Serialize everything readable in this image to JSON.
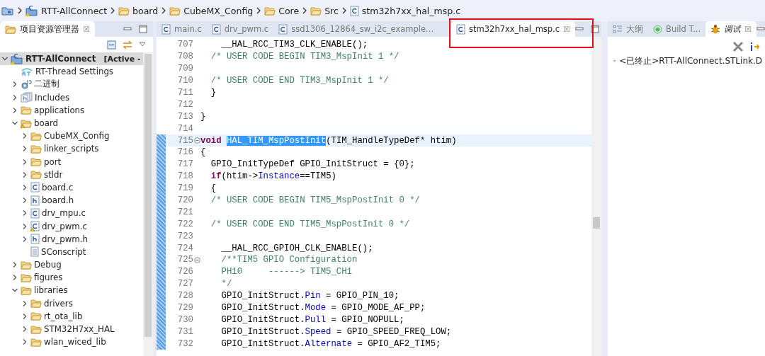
{
  "breadcrumb": [
    {
      "label": "RTT-AllConnect",
      "kind": "project"
    },
    {
      "label": "board",
      "kind": "folder"
    },
    {
      "label": "CubeMX_Config",
      "kind": "folder"
    },
    {
      "label": "Core",
      "kind": "folder"
    },
    {
      "label": "Src",
      "kind": "folder"
    },
    {
      "label": "stm32h7xx_hal_msp.c",
      "kind": "c-file"
    }
  ],
  "explorer": {
    "title": "项目资源管理器",
    "close": "☒",
    "tree": [
      {
        "label": "RTT-AllConnect",
        "suffix": "[Active - ",
        "kind": "project",
        "selected": true,
        "expanded": true,
        "children": [
          {
            "label": "RT-Thread Settings",
            "kind": "rt",
            "selected": false
          },
          {
            "label": "二进制",
            "kind": "binary",
            "selected": false,
            "expanded": false
          },
          {
            "label": "Includes",
            "kind": "includes",
            "selected": false,
            "expanded": false
          },
          {
            "label": "applications",
            "kind": "folder",
            "selected": false,
            "expanded": false
          },
          {
            "label": "board",
            "kind": "folder",
            "selected": false,
            "expanded": true,
            "warning": true,
            "children": [
              {
                "label": "CubeMX_Config",
                "kind": "folder",
                "selected": false,
                "expanded": false
              },
              {
                "label": "linker_scripts",
                "kind": "folder",
                "selected": false,
                "expanded": false
              },
              {
                "label": "port",
                "kind": "folder",
                "selected": false,
                "expanded": false
              },
              {
                "label": "stldr",
                "kind": "folder",
                "selected": false,
                "expanded": false
              },
              {
                "label": "board.c",
                "kind": "c-file",
                "selected": false,
                "expanded": false
              },
              {
                "label": "board.h",
                "kind": "h-file",
                "selected": false,
                "expanded": false
              },
              {
                "label": "drv_mpu.c",
                "kind": "c-file",
                "selected": false,
                "expanded": false
              },
              {
                "label": "drv_pwm.c",
                "kind": "c-file",
                "selected": false,
                "expanded": false,
                "warning": true
              },
              {
                "label": "drv_pwm.h",
                "kind": "h-file",
                "selected": false,
                "expanded": false
              },
              {
                "label": "SConscript",
                "kind": "text-file",
                "selected": false
              }
            ]
          },
          {
            "label": "Debug",
            "kind": "folder",
            "selected": false,
            "expanded": false
          },
          {
            "label": "figures",
            "kind": "folder",
            "selected": false,
            "expanded": false
          },
          {
            "label": "libraries",
            "kind": "folder",
            "selected": false,
            "expanded": true,
            "children": [
              {
                "label": "drivers",
                "kind": "folder",
                "selected": false,
                "expanded": false
              },
              {
                "label": "rt_ota_lib",
                "kind": "folder",
                "selected": false,
                "expanded": false
              },
              {
                "label": "STM32H7xx_HAL",
                "kind": "folder",
                "selected": false,
                "expanded": false
              },
              {
                "label": "wlan_wiced_lib",
                "kind": "folder",
                "selected": false,
                "expanded": false
              }
            ]
          }
        ]
      }
    ]
  },
  "editor": {
    "tabs": [
      {
        "label": "main.c",
        "selected": false
      },
      {
        "label": "drv_pwm.c",
        "selected": false
      },
      {
        "label": "ssd1306_12864_sw_i2c_example...",
        "selected": false
      },
      {
        "label": "stm32h7xx_hal_msp.c",
        "selected": true,
        "close": "☒",
        "marked": true
      }
    ],
    "lines": [
      {
        "number": "707",
        "changed": false,
        "current": false,
        "fold": false,
        "tokens": [
          {
            "text": "    __HAL_RCC_TIM3_CLK_ENABLE();",
            "kind": "plain"
          }
        ]
      },
      {
        "number": "708",
        "changed": false,
        "current": false,
        "fold": false,
        "tokens": [
          {
            "text": "  /* USER CODE BEGIN TIM3_MspInit 1 */",
            "kind": "comment"
          }
        ]
      },
      {
        "number": "709",
        "changed": false,
        "current": false,
        "fold": false
      },
      {
        "number": "710",
        "changed": false,
        "current": false,
        "fold": false,
        "tokens": [
          {
            "text": "  /* USER CODE END TIM3_MspInit 1 */",
            "kind": "comment"
          }
        ]
      },
      {
        "number": "711",
        "changed": false,
        "current": false,
        "fold": false,
        "tokens": [
          {
            "text": "  }",
            "kind": "plain"
          }
        ]
      },
      {
        "number": "712",
        "changed": false,
        "current": false,
        "fold": false
      },
      {
        "number": "713",
        "changed": false,
        "current": false,
        "fold": false,
        "tokens": [
          {
            "text": "}",
            "kind": "plain"
          }
        ]
      },
      {
        "number": "714",
        "changed": false,
        "current": false,
        "fold": false
      },
      {
        "number": "715",
        "changed": true,
        "current": true,
        "fold": true,
        "tokens": [
          {
            "text": "void ",
            "kind": "keyword"
          },
          {
            "text": "HAL_TIM_MspPostInit",
            "kind": "selected"
          },
          {
            "text": "(TIM_HandleTypeDef* htim)",
            "kind": "plain"
          }
        ]
      },
      {
        "number": "716",
        "changed": true,
        "current": false,
        "fold": false,
        "tokens": [
          {
            "text": "{",
            "kind": "plain"
          }
        ]
      },
      {
        "number": "717",
        "changed": true,
        "current": false,
        "fold": false,
        "tokens": [
          {
            "text": "  GPIO_InitTypeDef GPIO_InitStruct = {0};",
            "kind": "plain"
          }
        ]
      },
      {
        "number": "718",
        "changed": true,
        "current": false,
        "fold": false,
        "tokens": [
          {
            "text": "  if",
            "kind": "keyword"
          },
          {
            "text": "(htim->",
            "kind": "plain"
          },
          {
            "text": "Instance",
            "kind": "field"
          },
          {
            "text": "==TIM5)",
            "kind": "plain"
          }
        ]
      },
      {
        "number": "719",
        "changed": true,
        "current": false,
        "fold": false,
        "tokens": [
          {
            "text": "  {",
            "kind": "plain"
          }
        ]
      },
      {
        "number": "720",
        "changed": true,
        "current": false,
        "fold": false,
        "tokens": [
          {
            "text": "  /* USER CODE BEGIN TIM5_MspPostInit 0 */",
            "kind": "comment"
          }
        ]
      },
      {
        "number": "721",
        "changed": true,
        "current": false,
        "fold": false
      },
      {
        "number": "722",
        "changed": true,
        "current": false,
        "fold": false,
        "tokens": [
          {
            "text": "  /* USER CODE END TIM5_MspPostInit 0 */",
            "kind": "comment"
          }
        ]
      },
      {
        "number": "723",
        "changed": true,
        "current": false,
        "fold": false
      },
      {
        "number": "724",
        "changed": true,
        "current": false,
        "fold": false,
        "tokens": [
          {
            "text": "    __HAL_RCC_GPIOH_CLK_ENABLE();",
            "kind": "plain"
          }
        ]
      },
      {
        "number": "725",
        "changed": true,
        "current": false,
        "fold": true,
        "tokens": [
          {
            "text": "    /**TIM5 GPIO Configuration",
            "kind": "comment"
          }
        ]
      },
      {
        "number": "726",
        "changed": true,
        "current": false,
        "fold": false,
        "tokens": [
          {
            "text": "    PH10     ------> TIM5_CH1",
            "kind": "comment"
          }
        ]
      },
      {
        "number": "727",
        "changed": true,
        "current": false,
        "fold": false,
        "tokens": [
          {
            "text": "    */",
            "kind": "comment"
          }
        ]
      },
      {
        "number": "728",
        "changed": true,
        "current": false,
        "fold": false,
        "tokens": [
          {
            "text": "    GPIO_InitStruct.",
            "kind": "plain"
          },
          {
            "text": "Pin",
            "kind": "field"
          },
          {
            "text": " = GPIO_PIN_10;",
            "kind": "plain"
          }
        ]
      },
      {
        "number": "729",
        "changed": true,
        "current": false,
        "fold": false,
        "tokens": [
          {
            "text": "    GPIO_InitStruct.",
            "kind": "plain"
          },
          {
            "text": "Mode",
            "kind": "field"
          },
          {
            "text": " = GPIO_MODE_AF_PP;",
            "kind": "plain"
          }
        ]
      },
      {
        "number": "730",
        "changed": true,
        "current": false,
        "fold": false,
        "tokens": [
          {
            "text": "    GPIO_InitStruct.",
            "kind": "plain"
          },
          {
            "text": "Pull",
            "kind": "field"
          },
          {
            "text": " = GPIO_NOPULL;",
            "kind": "plain"
          }
        ]
      },
      {
        "number": "731",
        "changed": true,
        "current": false,
        "fold": false,
        "tokens": [
          {
            "text": "    GPIO_InitStruct.",
            "kind": "plain"
          },
          {
            "text": "Speed",
            "kind": "field"
          },
          {
            "text": " = GPIO_SPEED_FREQ_LOW;",
            "kind": "plain"
          }
        ]
      },
      {
        "number": "732",
        "changed": true,
        "current": false,
        "fold": false,
        "tokens": [
          {
            "text": "    GPIO_InitStruct.",
            "kind": "plain"
          },
          {
            "text": "Alternate",
            "kind": "field"
          },
          {
            "text": " = GPIO_AF2_TIM5;",
            "kind": "plain"
          }
        ]
      }
    ]
  },
  "right_panel": {
    "tabs": [
      {
        "label": "大纲",
        "kind": "outline",
        "selected": false
      },
      {
        "label": "Build T...",
        "kind": "build",
        "selected": false
      },
      {
        "label": "调试",
        "kind": "debug",
        "selected": true,
        "close": "☒"
      }
    ],
    "toolbar": [
      {
        "kind": "remove"
      },
      {
        "kind": "step"
      }
    ],
    "items": [
      {
        "label": "<已终止>RTT-AllConnect.STLink.D",
        "kind": "launch"
      }
    ]
  }
}
